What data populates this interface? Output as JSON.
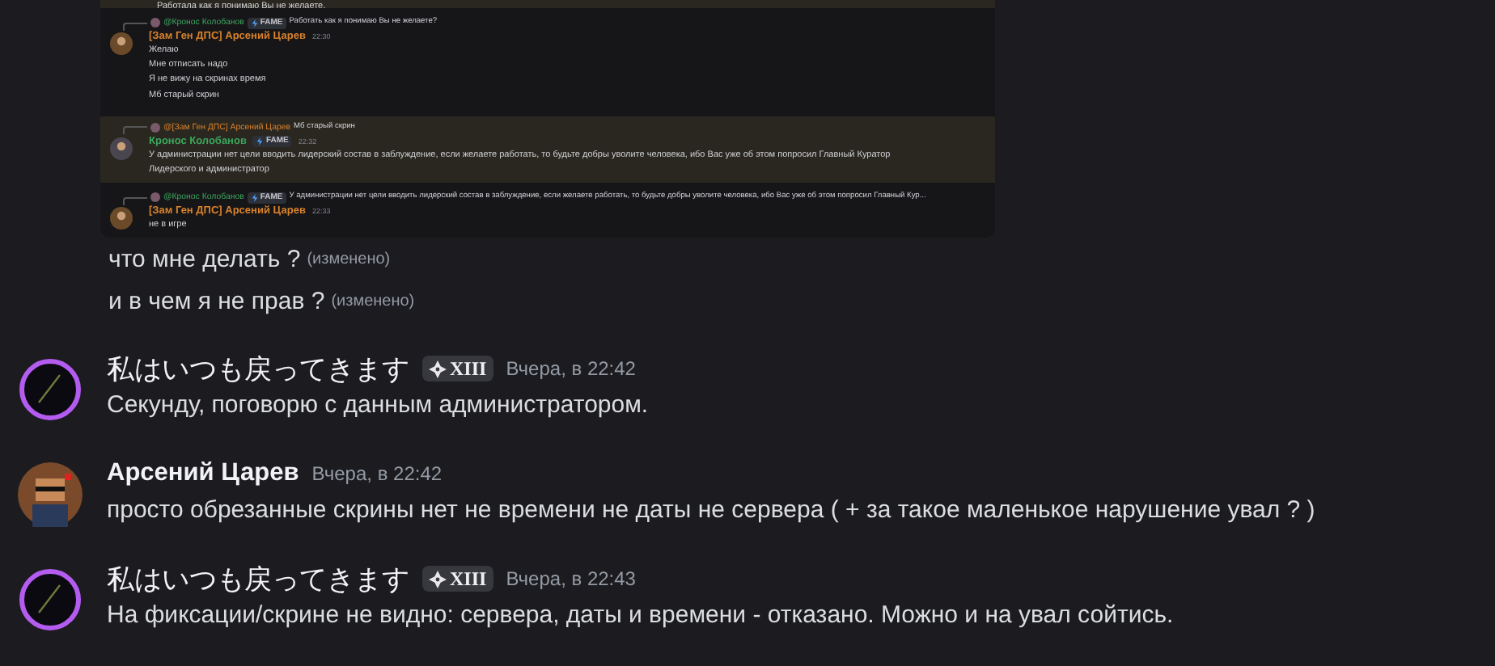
{
  "embedded_screenshot": {
    "top_line": "Работала как я понимаю Вы не желаете.",
    "messages": [
      {
        "highlighted": false,
        "reply": {
          "author": "@Кронос Колобанов",
          "color": "#3ba55c",
          "badge": "FAME",
          "text": "Работать как я понимаю Вы не желаете?"
        },
        "author": "[Зам Ген ДПС] Арсений Царев",
        "color": "#d9822b",
        "time": "22:30",
        "lines": [
          "Желаю",
          "Мне отписать надо",
          "Я не вижу на скринах время",
          "Мб старый скрин"
        ]
      },
      {
        "highlighted": true,
        "reply": {
          "author": "@[Зам Ген ДПС] Арсений Царев",
          "color": "#d9822b",
          "text": "Мб старый скрин"
        },
        "author": "Кронос Колобанов",
        "color": "#3ba55c",
        "badge": "FAME",
        "time": "22:32",
        "lines": [
          "У администрации нет цели вводить лидерский состав в заблуждение, если желаете работать, то будьте добры уволите человека, ибо Вас уже об этом попросил Главный Куратор",
          "Лидерского и администратор"
        ]
      },
      {
        "highlighted": false,
        "reply": {
          "author": "@Кронос Колобанов",
          "color": "#3ba55c",
          "badge": "FAME",
          "text": "У администрации нет цели вводить лидерский состав в заблуждение, если желаете работать, то будьте добры уволите человека, ибо Вас уже об этом попросил Главный Кур..."
        },
        "author": "[Зам Ген ДПС] Арсений Царев",
        "color": "#d9822b",
        "time": "22:33",
        "lines": [
          "не в игре"
        ]
      }
    ]
  },
  "messages": [
    {
      "kind": "continuation",
      "text": "что мне делать ?",
      "edited": "(изменено)"
    },
    {
      "kind": "continuation",
      "text": "и в чем я не прав ?",
      "edited": "(изменено)"
    },
    {
      "kind": "full",
      "avatar": {
        "kind": "ring"
      },
      "author": "私はいつも戻ってきます",
      "badge": "XIII",
      "time": "Вчера, в 22:42",
      "text": "Секунду, поговорю с данным администратором."
    },
    {
      "kind": "full",
      "avatar": {
        "kind": "pixel"
      },
      "author": "Арсений Царев",
      "time": "Вчера, в 22:42",
      "text": "просто обрезанные скрины нет не времени не даты не сервера ( + за такое маленькое нарушение увал ? )"
    },
    {
      "kind": "full",
      "avatar": {
        "kind": "ring"
      },
      "author": "私はいつも戻ってきます",
      "badge": "XIII",
      "time": "Вчера, в 22:43",
      "text": "На фиксации/скрине не видно: сервера, даты и времени - отказано. Можно и на увал сойтись."
    }
  ]
}
